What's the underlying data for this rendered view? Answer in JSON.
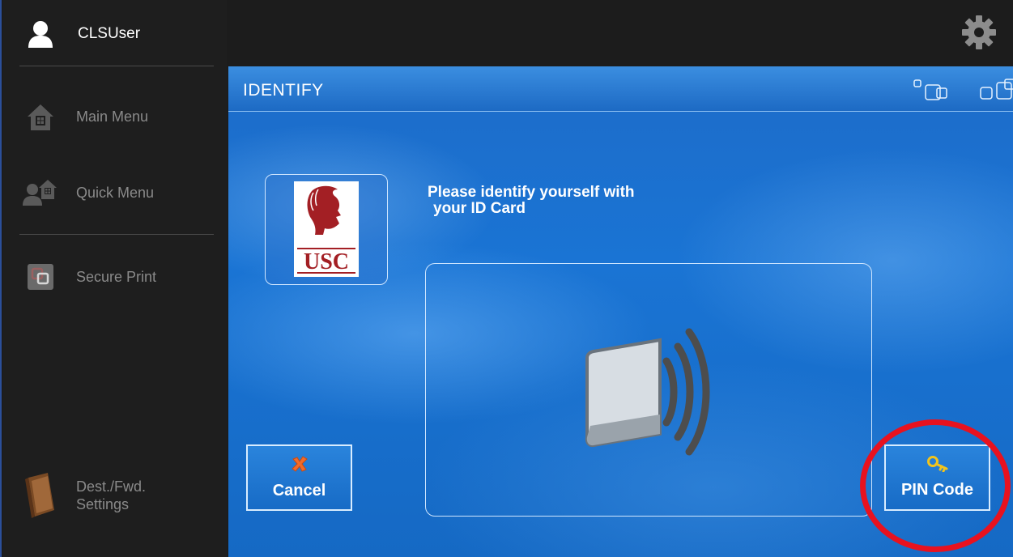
{
  "sidebar": {
    "user": {
      "name": "CLSUser",
      "icon": "user-icon"
    },
    "items": [
      {
        "label": "Main Menu",
        "icon": "home-icon"
      },
      {
        "label": "Quick Menu",
        "icon": "quick-menu-icon"
      },
      {
        "label": "Secure Print",
        "icon": "secure-print-icon"
      },
      {
        "label": "Dest./Fwd.",
        "label2": "Settings",
        "icon": "address-book-icon"
      }
    ]
  },
  "topbar": {
    "settings_icon": "gear-icon"
  },
  "panel": {
    "title": "IDENTIFY",
    "logo_text": "USC",
    "instruction_line1": "Please identify yourself with",
    "instruction_line2": "your ID Card",
    "reader_icon": "card-reader-icon"
  },
  "buttons": {
    "cancel_label": "Cancel",
    "cancel_icon": "close-icon",
    "pin_label": "PIN Code",
    "pin_icon": "key-icon"
  },
  "colors": {
    "accent_blue": "#1a74d4",
    "highlight_red": "#e8121f",
    "sidebar_bg": "#1e1e1e",
    "usc_cardinal": "#a31f24"
  }
}
